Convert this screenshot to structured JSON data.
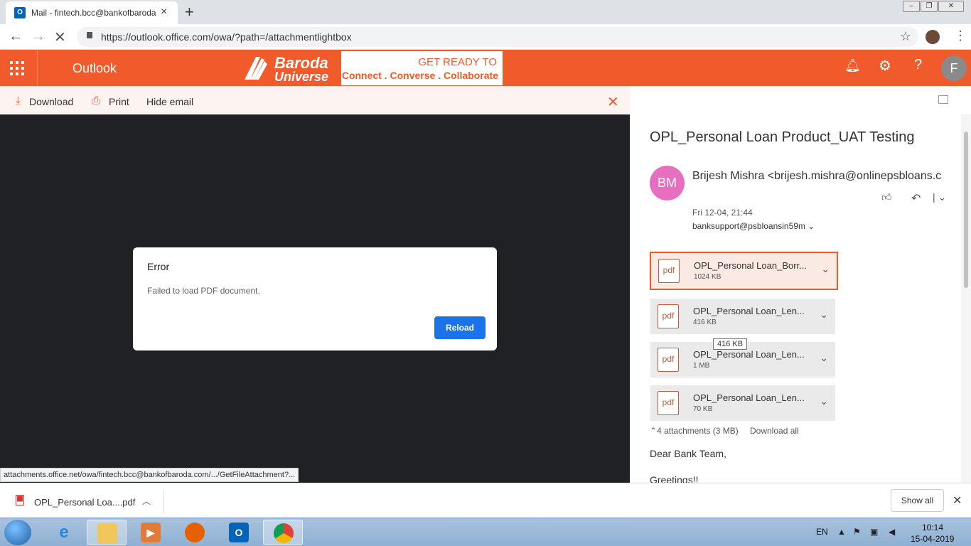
{
  "browser": {
    "tab_title": "Mail - fintech.bcc@bankofbaroda",
    "url": "https://outlook.office.com/owa/?path=/attachmentlightbox"
  },
  "outlook_header": {
    "app_name": "Outlook",
    "brand_logo_text": "Baroda Universe",
    "brand_line1": "GET READY TO",
    "brand_line2": "Connect . Converse . Collaborate",
    "profile_initial": "F"
  },
  "actions": {
    "download": "Download",
    "print": "Print",
    "hide_email": "Hide email"
  },
  "viewer": {
    "dialog_title": "Error",
    "dialog_message": "Failed to load PDF document.",
    "reload_label": "Reload",
    "status_url": "attachments.office.net/owa/fintech.bcc@bankofbaroda.com/.../GetFileAttachment?..."
  },
  "email": {
    "subject": "OPL_Personal Loan Product_UAT Testing",
    "sender_initials": "BM",
    "sender": "Brijesh Mishra <brijesh.mishra@onlinepsbloans.c",
    "date": "Fri 12-04, 21:44",
    "to": "banksupport@psbloansin59m",
    "attachments": [
      {
        "name": "OPL_Personal Loan_Borr...",
        "size": "1024 KB"
      },
      {
        "name": "OPL_Personal Loan_Len...",
        "size": "416 KB"
      },
      {
        "name": "OPL_Personal Loan_Len...",
        "size": "1 MB"
      },
      {
        "name": "OPL_Personal Loan_Len...",
        "size": "70 KB"
      }
    ],
    "tooltip": "416 KB",
    "attachments_summary": "4 attachments (3 MB)",
    "download_all": "Download all",
    "body_line1": "Dear Bank Team,",
    "body_line2": "Greetings!!"
  },
  "download_shelf": {
    "file_name": "OPL_Personal Loa....pdf",
    "show_all": "Show all"
  },
  "taskbar": {
    "language": "EN",
    "time": "10:14",
    "date": "15-04-2019"
  },
  "colors": {
    "outlook_accent": "#f15a2a",
    "reload_button": "#1a73e8",
    "viewer_bg": "#202124",
    "avatar_bm": "#e86fc0"
  }
}
